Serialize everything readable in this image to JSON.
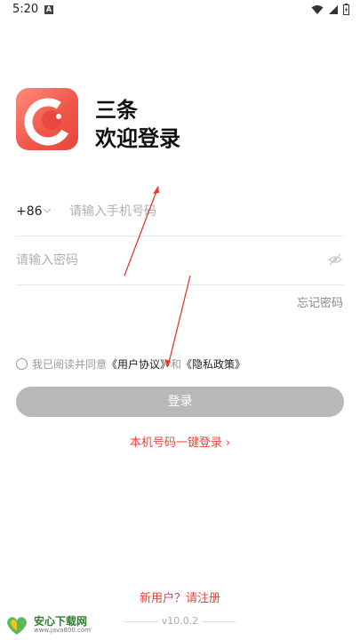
{
  "status_bar": {
    "time": "5:20",
    "a_label": "A"
  },
  "brand": {
    "name": "三条",
    "welcome": "欢迎登录"
  },
  "phone": {
    "country_code": "+86",
    "placeholder": "请输入手机号码"
  },
  "password": {
    "placeholder": "请输入密码"
  },
  "forgot_password": "忘记密码",
  "agreement": {
    "prefix": "我已阅读并同意",
    "user_agreement": "《用户协议》",
    "and": "和",
    "privacy_policy": "《隐私政策》"
  },
  "login_button": "登录",
  "onekey_login": "本机号码一键登录 ›",
  "register_link": "新用户？请注册",
  "version": "v10.0.2",
  "watermark": {
    "main": "安心下载网",
    "sub": "www.java800.com"
  },
  "colors": {
    "accent": "#e8453c",
    "button_disabled": "#b8b8b8"
  }
}
